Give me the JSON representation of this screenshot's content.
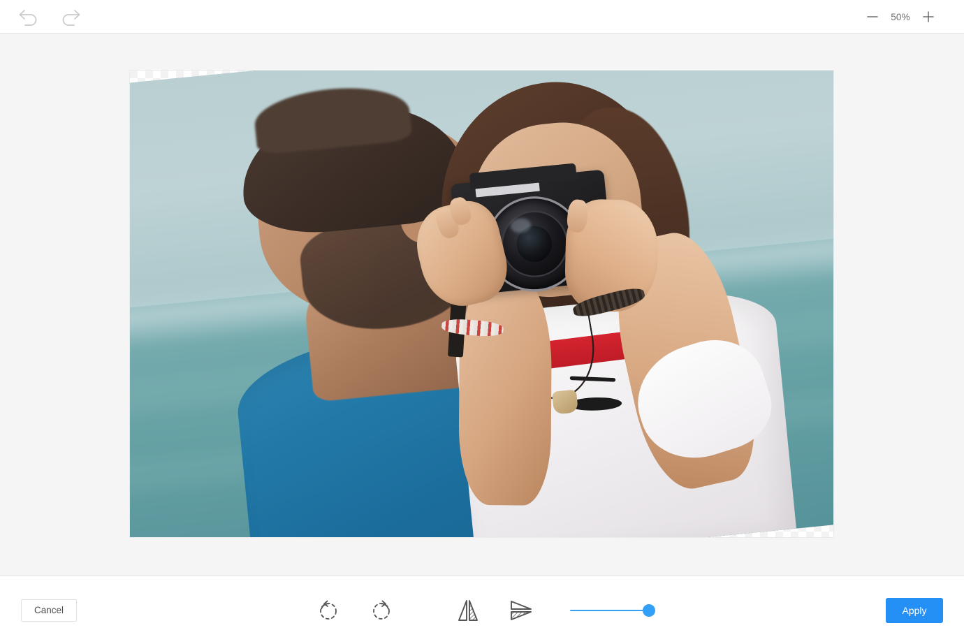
{
  "header": {
    "undo_label": "Undo",
    "redo_label": "Redo",
    "zoom": {
      "decrease_label": "Zoom out",
      "level": "50%",
      "increase_label": "Zoom in"
    }
  },
  "canvas": {
    "transparency_label": "Transparent background",
    "photo_alt": "Man and woman at the sea, woman photographing with an Olympus camera",
    "rotation_degrees": "-5.6"
  },
  "footer": {
    "cancel_label": "Cancel",
    "apply_label": "Apply",
    "tools": [
      {
        "name": "rotate-left",
        "label": "Rotate left"
      },
      {
        "name": "rotate-right",
        "label": "Rotate right"
      },
      {
        "name": "flip-horizontal",
        "label": "Flip horizontal"
      },
      {
        "name": "flip-vertical",
        "label": "Flip vertical"
      }
    ],
    "slider": {
      "label": "Straighten",
      "value": "100",
      "min": "0",
      "max": "100"
    }
  },
  "colors": {
    "accent": "#2490f5",
    "slider": "#33a0f8",
    "icon": "#555555",
    "header_icon": "#c9c9c9",
    "stage_bg": "#f5f5f5",
    "border": "#e4e4e4",
    "text": "#4d4d4d"
  }
}
